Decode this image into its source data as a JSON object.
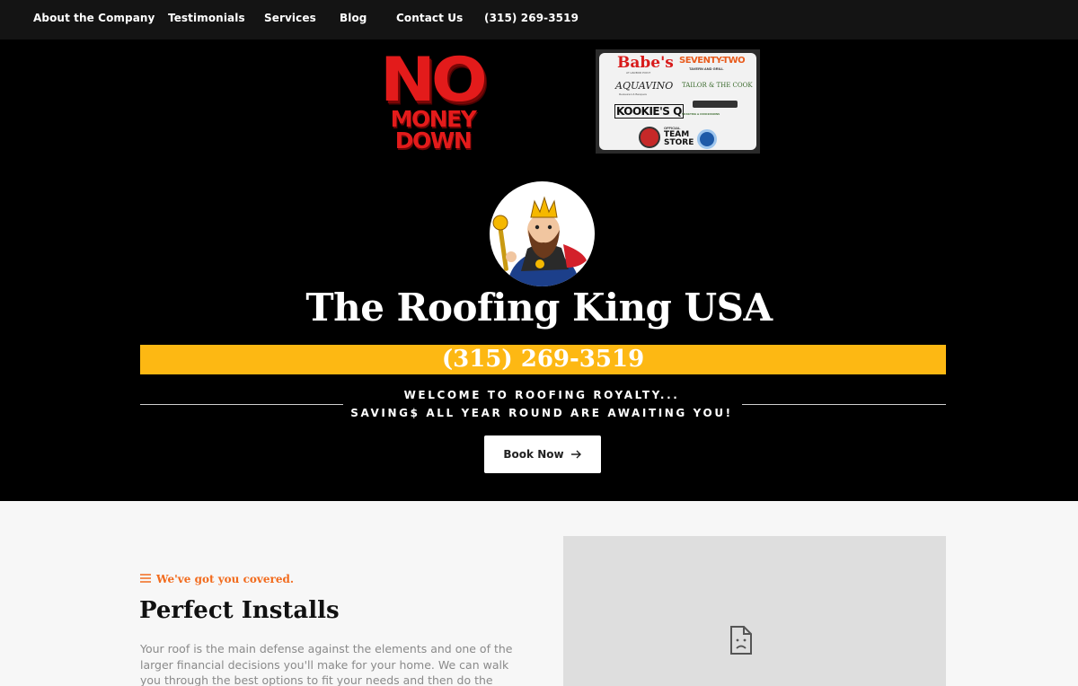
{
  "nav": {
    "items": [
      "About the Company",
      "Testimonials",
      "Services",
      "Blog",
      "Contact Us",
      "(315) 269-3519"
    ]
  },
  "hero": {
    "promo": {
      "line1": "NO",
      "line2": "MONEY",
      "line3": "DOWN"
    },
    "sponsors": {
      "babes": "Babe's",
      "babes_sub": "AT HARBOR POINT",
      "seventy_two": "SEVENTY-TWO",
      "seventy_two_sub": "TAVERN AND GRILL",
      "aqua_vino": "AQUAVINO",
      "aqua_vino_sub": "Restaurant & Banquets",
      "tailor": "TAILOR & THE COOK",
      "kookies": "KOOKIE'S Q",
      "team_store": "TEAM STORE",
      "team_store_sub": "OFFICIAL",
      "concessions_sub": "TICKETING & CONCESSIONS"
    },
    "title": "The Roofing King USA",
    "phone": "(315) 269-3519",
    "welcome_line1": "WELCOME TO ROOFING ROYALTY...",
    "welcome_line2": "SAVING$ ALL YEAR ROUND ARE AWAITING YOU!",
    "book_button": "Book Now"
  },
  "section": {
    "eyebrow": "We've got you covered.",
    "heading": "Perfect Installs",
    "paragraph": "Your roof is the main defense against the elements and one of the larger financial decisions you'll make for your home. We can walk you through the best options to fit your needs and then do the complete installation"
  },
  "colors": {
    "nav_bg": "#141414",
    "hero_bg": "#000000",
    "accent_yellow": "#fdb813",
    "accent_orange": "#f26b1d",
    "promo_red": "#e31b1b"
  },
  "icons": {
    "eyebrow": "menu-lines-icon",
    "book": "arrow-right-icon",
    "image_placeholder": "broken-image-icon"
  }
}
